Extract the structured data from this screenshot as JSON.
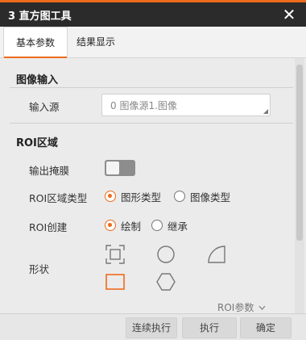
{
  "window": {
    "title": "3 直方图工具",
    "close_glyph": "✕"
  },
  "tabs": [
    {
      "label": "基本参数",
      "active": true
    },
    {
      "label": "结果显示",
      "active": false
    }
  ],
  "image_input": {
    "section_title": "图像输入",
    "source_label": "输入源",
    "source_value": "0 图像源1.图像"
  },
  "roi_area": {
    "section_title": "ROI区域",
    "output_mask_label": "输出掩膜",
    "output_mask_on": false,
    "roi_type_label": "ROI区域类型",
    "roi_type_options": [
      "图形类型",
      "图像类型"
    ],
    "roi_type_selected": "图形类型",
    "roi_create_label": "ROI创建",
    "roi_create_options": [
      "绘制",
      "继承"
    ],
    "roi_create_selected": "绘制",
    "shape_label": "形状",
    "shapes": [
      "fullscreen-rect-icon",
      "circle-icon",
      "sector-icon",
      "rectangle-icon",
      "polygon-icon"
    ],
    "roi_params_label": "ROI参数"
  },
  "footer": {
    "continuous_label": "连续执行",
    "execute_label": "执行",
    "confirm_label": "确定"
  },
  "colors": {
    "accent": "#ee6a1c",
    "titlebar_bg": "#2b2b2b",
    "panel_bg": "#ebebeb"
  }
}
